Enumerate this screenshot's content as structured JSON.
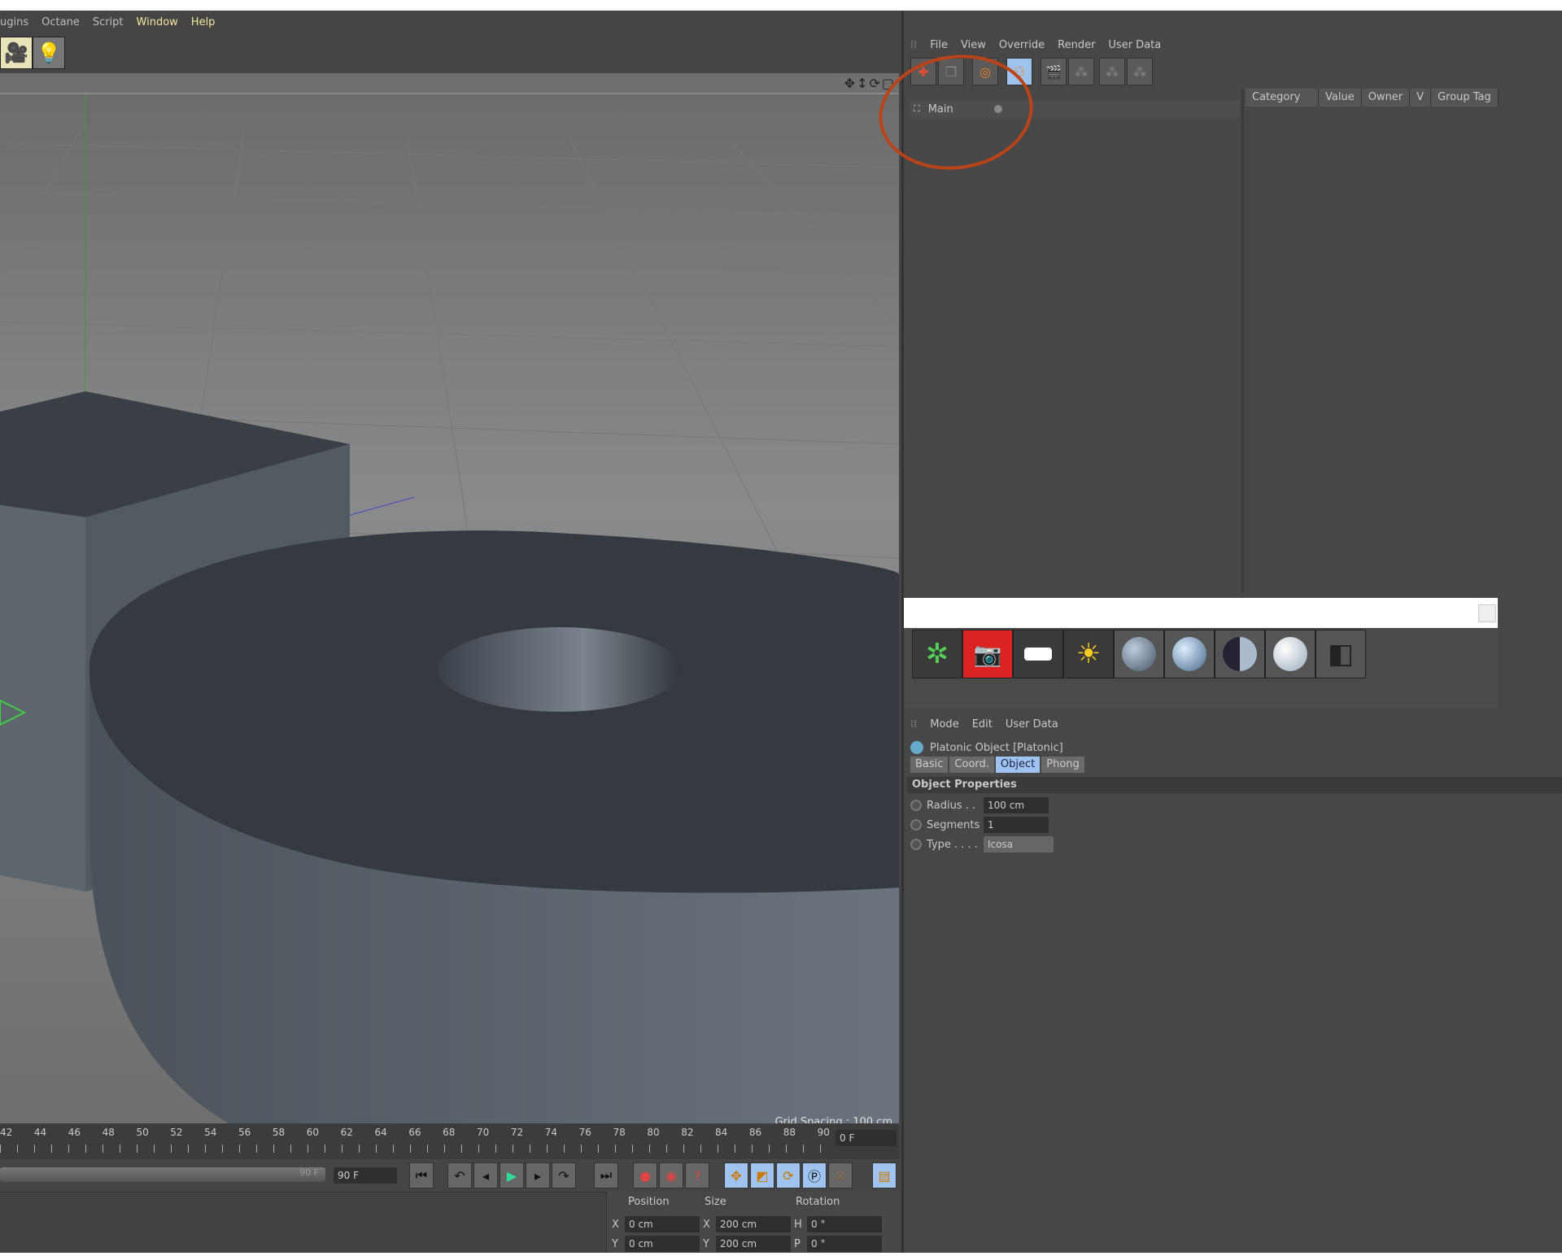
{
  "menubar": {
    "items": [
      "ugins",
      "Octane",
      "Script",
      "Window",
      "Help"
    ]
  },
  "viewport": {
    "grid_spacing": "Grid Spacing : 100 cm",
    "nav_icons": [
      "move-icon",
      "pan-icon",
      "rotate-icon",
      "maximize-icon"
    ]
  },
  "timeline": {
    "ticks": [
      "42",
      "44",
      "46",
      "48",
      "50",
      "52",
      "54",
      "56",
      "58",
      "60",
      "62",
      "64",
      "66",
      "68",
      "70",
      "72",
      "74",
      "76",
      "78",
      "80",
      "82",
      "84",
      "86",
      "88",
      "90"
    ],
    "current_frame": "0 F",
    "end_marker": "90 F",
    "end_frame": "90 F"
  },
  "coord_panel": {
    "headers": [
      "Position",
      "Size",
      "Rotation"
    ],
    "rows": [
      {
        "a": "X",
        "pos": "0 cm",
        "s": "X",
        "size": "200 cm",
        "r": "H",
        "rot": "0 °"
      },
      {
        "a": "Y",
        "pos": "0 cm",
        "s": "Y",
        "size": "200 cm",
        "r": "P",
        "rot": "0 °"
      }
    ]
  },
  "take_manager": {
    "menu": [
      "File",
      "View",
      "Override",
      "Render",
      "User Data"
    ],
    "tree_item": "Main",
    "columns": [
      "Category",
      "Value",
      "Owner",
      "V",
      "Group Tag"
    ]
  },
  "attributes": {
    "menu": [
      "Mode",
      "Edit",
      "User Data"
    ],
    "object_title": "Platonic Object [Platonic]",
    "tabs": [
      "Basic",
      "Coord.",
      "Object",
      "Phong"
    ],
    "active_tab": "Object",
    "section": "Object Properties",
    "fields": [
      {
        "label": "Radius . .",
        "value": "100 cm"
      },
      {
        "label": "Segments",
        "value": "1"
      },
      {
        "label": "Type . . . .",
        "value": "Icosa"
      }
    ]
  },
  "colors": {
    "annotation_circle": "#b9441a",
    "active_tab": "#9ec3ee",
    "menu_highlight": "#f2e8a0"
  }
}
